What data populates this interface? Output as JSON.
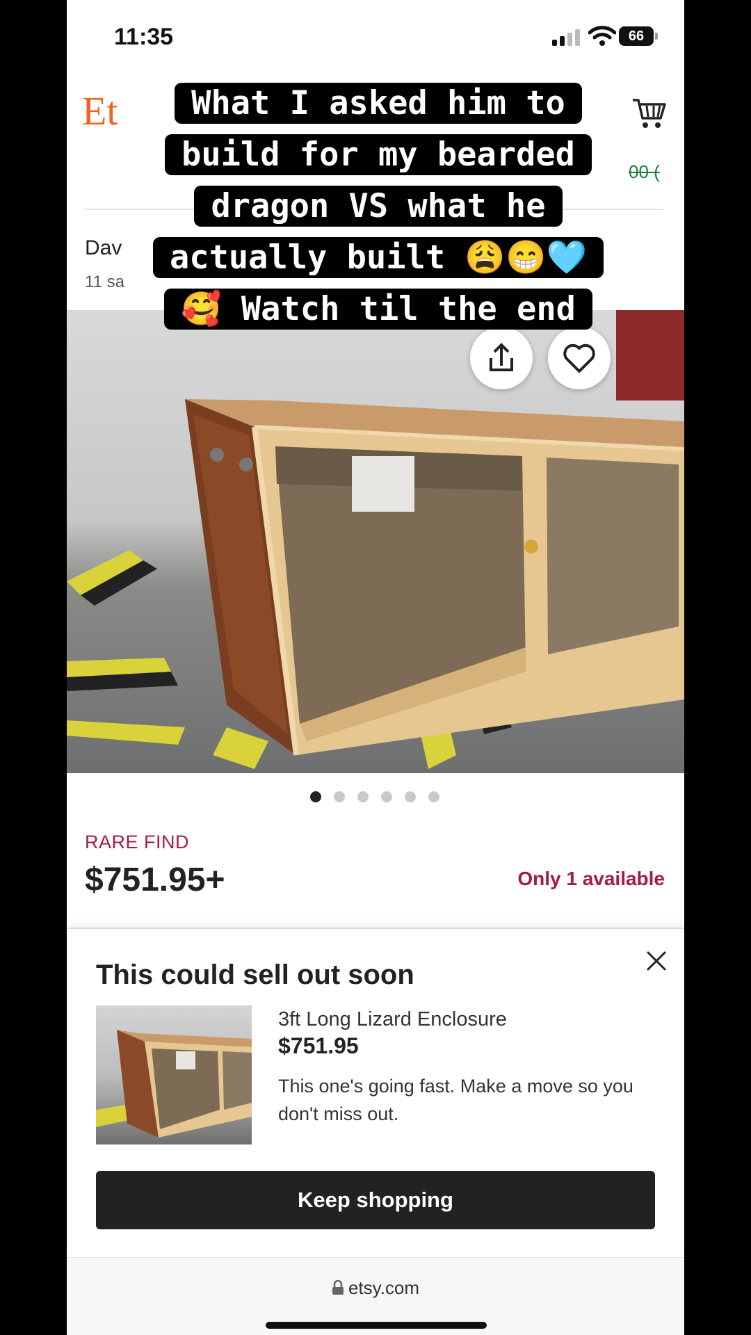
{
  "status_bar": {
    "time": "11:35",
    "battery": "66"
  },
  "header": {
    "logo": "Et",
    "strike_price_fragment": "00 ("
  },
  "shop": {
    "name": "Dav",
    "sales": "11 sa"
  },
  "gallery": {
    "dots_total": 6,
    "active_index": 0
  },
  "listing": {
    "badge": "RARE FIND",
    "price": "$751.95+",
    "availability": "Only 1 available"
  },
  "popup": {
    "title": "This could sell out soon",
    "item_name": "3ft Long Lizard Enclosure",
    "item_price": "$751.95",
    "message": "This one's going fast. Make a move so you don't miss out.",
    "button_label": "Keep shopping"
  },
  "browser": {
    "url": "etsy.com"
  },
  "caption": {
    "lines": [
      "What I asked him to",
      "build for my bearded",
      "dragon VS what he",
      "actually built 😩😁🩵",
      "🥰 Watch til the end"
    ]
  },
  "icons": {
    "cart": "cart-icon",
    "share": "share-icon",
    "favorite": "heart-icon",
    "close": "close-icon",
    "lock": "lock-icon",
    "wifi": "wifi-icon",
    "signal": "signal-icon"
  },
  "colors": {
    "etsy_orange": "#f1641e",
    "accent_red": "#a61a4a",
    "sale_green": "#1a7e3c",
    "button_dark": "#222222"
  }
}
